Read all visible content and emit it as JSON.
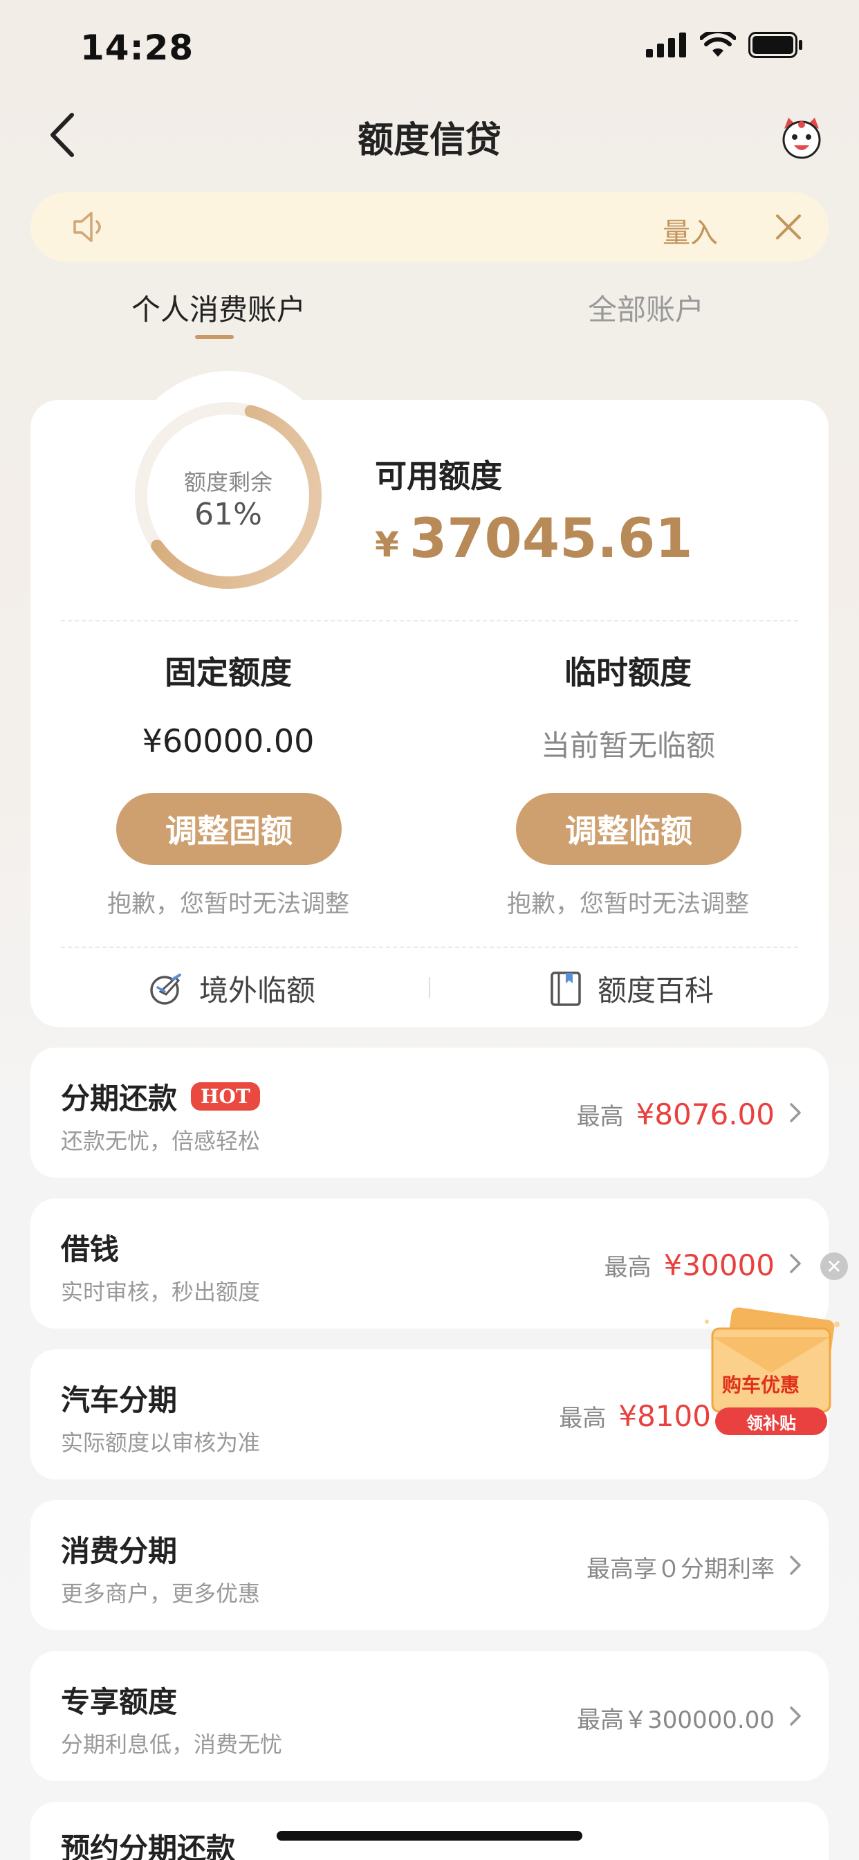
{
  "status_bar": {
    "time": "14:28"
  },
  "nav": {
    "title": "额度信贷"
  },
  "notice": {
    "text": "量入"
  },
  "tabs": [
    {
      "label": "个人消费账户",
      "active": true
    },
    {
      "label": "全部账户",
      "active": false
    }
  ],
  "credit": {
    "remaining_label": "额度剩余",
    "remaining_percent": "61%",
    "remaining_fraction": 0.61,
    "available_label": "可用额度",
    "currency": "¥",
    "available_amount": "37045.61"
  },
  "fixed": {
    "title": "固定额度",
    "value": "¥60000.00",
    "button": "调整固额",
    "note": "抱歉，您暂时无法调整"
  },
  "temporary": {
    "title": "临时额度",
    "value": "当前暂无临额",
    "button": "调整临额",
    "note": "抱歉，您暂时无法调整"
  },
  "links": {
    "overseas": "境外临额",
    "encyclopedia": "额度百科"
  },
  "list": [
    {
      "title": "分期还款",
      "badge": "HOT",
      "subtitle": "还款无忧，倍感轻松",
      "prefix": "最高",
      "amount": "¥8076.00"
    },
    {
      "title": "借钱",
      "subtitle": "实时审核，秒出额度",
      "prefix": "最高",
      "amount": "¥30000"
    },
    {
      "title": "汽车分期",
      "subtitle": "实际额度以审核为准",
      "prefix": "最高",
      "amount": "¥8100"
    },
    {
      "title": "消费分期",
      "subtitle": "更多商户，更多优惠",
      "text": "最高享０分期利率"
    },
    {
      "title": "专享额度",
      "subtitle": "分期利息低，消费无忧",
      "text": "最高￥300000.00"
    },
    {
      "title": "预约分期还款",
      "subtitle": "",
      "text": ""
    }
  ],
  "promo": {
    "title": "购车优惠",
    "button": "领补贴"
  },
  "colors": {
    "accent": "#cfa06f",
    "highlight": "#e8413f",
    "gold_text": "#b88a57"
  }
}
